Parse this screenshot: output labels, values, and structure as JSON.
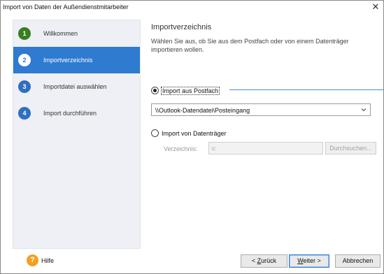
{
  "window": {
    "title": "Import von Daten der Außendienstmitarbeiter",
    "close_glyph": "✕"
  },
  "steps": [
    {
      "number": "1",
      "label": "Willkommen",
      "state": "done",
      "color": "#3a7d22"
    },
    {
      "number": "2",
      "label": "Importverzeichnis",
      "state": "active",
      "color": "#2e7bd0"
    },
    {
      "number": "3",
      "label": "Importdatei auswählen",
      "state": "pending",
      "color": "#2e6fc0"
    },
    {
      "number": "4",
      "label": "Import durchführen",
      "state": "pending",
      "color": "#2e6fc0"
    }
  ],
  "content": {
    "heading": "Importverzeichnis",
    "description": "Wählen Sie aus, ob Sie aus dem Postfach oder von einem Datenträger importieren wollen.",
    "option_mailbox": {
      "label": "Import aus Postfach",
      "selected": true
    },
    "mailbox_select": {
      "value": "\\\\Outlook-Datendatei\\Posteingang"
    },
    "option_drive": {
      "label": "Import von Datenträger",
      "selected": false
    },
    "directory": {
      "label": "Verzeichnis:",
      "value": "c:"
    },
    "browse_label": "Durchsuchen..."
  },
  "footer": {
    "help_icon_glyph": "?",
    "help_label": "Hilfe",
    "back_accel": "Z",
    "back_rest": "urück",
    "back_prefix": "< ",
    "next_accel": "W",
    "next_rest": "eiter >",
    "cancel_label": "Abbrechen"
  },
  "colors": {
    "accent": "#2e7bd0",
    "done": "#3a7d22",
    "help": "#f0a020"
  }
}
